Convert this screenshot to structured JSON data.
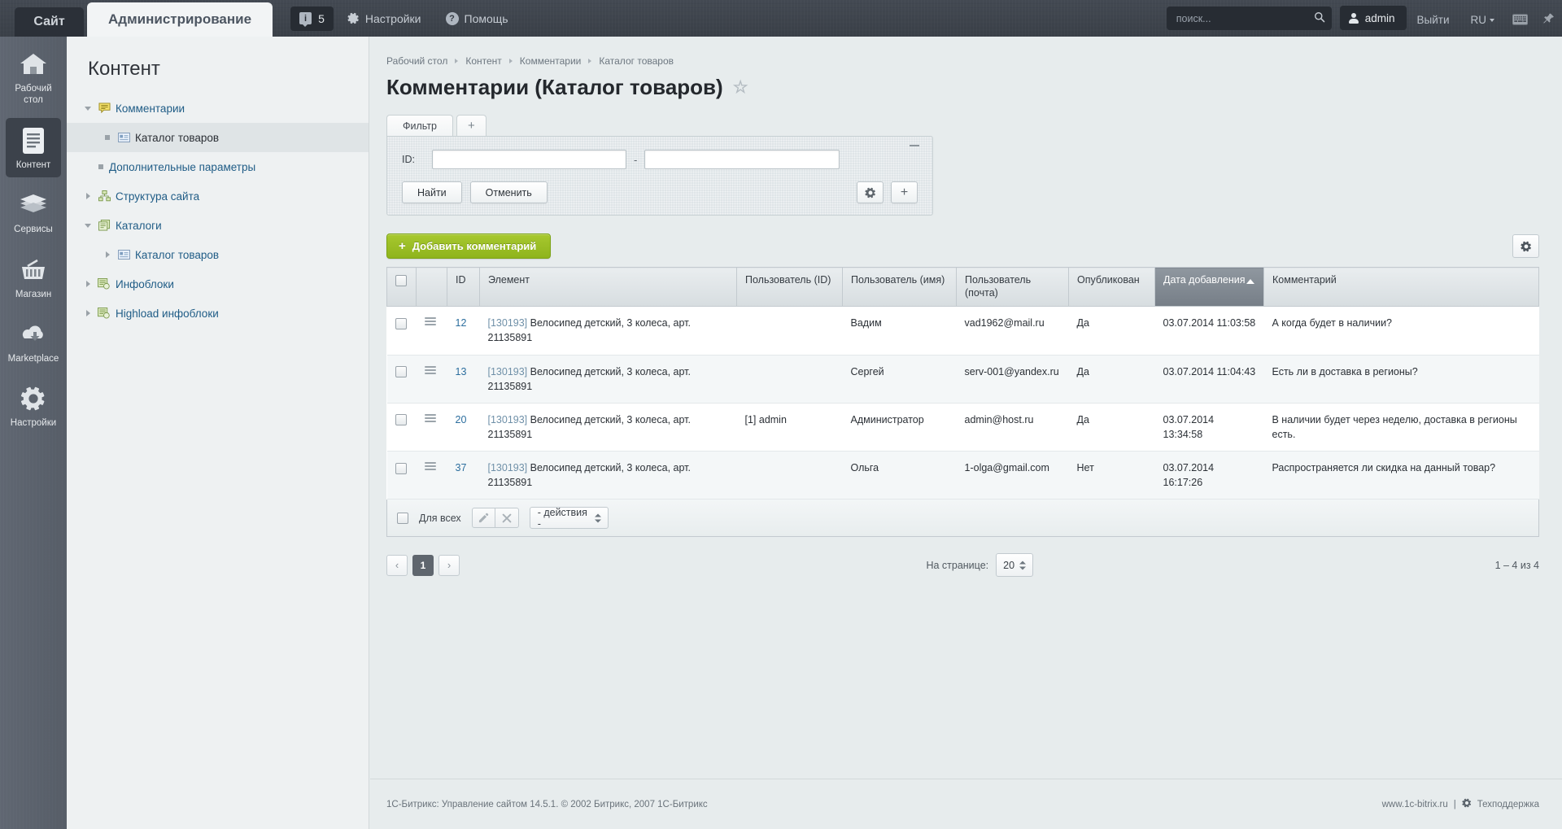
{
  "header": {
    "tab_site": "Сайт",
    "tab_admin": "Администрирование",
    "counter_badge_icon": "info-icon",
    "counter_value": "5",
    "settings_label": "Настройки",
    "help_label": "Помощь",
    "search_placeholder": "поиск...",
    "search_value": "",
    "user_name": "admin",
    "logout_label": "Выйти",
    "language": "RU",
    "keyboard_icon": "keyboard-icon",
    "pin_icon": "pin-icon"
  },
  "rail": {
    "items": [
      {
        "label": "Рабочий стол",
        "icon": "home-icon",
        "active": false
      },
      {
        "label": "Контент",
        "icon": "document-icon",
        "active": true
      },
      {
        "label": "Сервисы",
        "icon": "layers-icon",
        "active": false
      },
      {
        "label": "Магазин",
        "icon": "basket-icon",
        "active": false
      },
      {
        "label": "Marketplace",
        "icon": "cloud-download-icon",
        "active": false
      },
      {
        "label": "Настройки",
        "icon": "gear-icon",
        "active": false
      }
    ]
  },
  "tree": {
    "title": "Контент",
    "items": [
      {
        "label": "Комментарии",
        "icon": "comment-icon",
        "toggle": "down",
        "level": 0,
        "selected": false
      },
      {
        "label": "Каталог товаров",
        "icon": "card-icon",
        "toggle": "dot",
        "level": 1,
        "selected": true
      },
      {
        "label": "Дополнительные параметры",
        "icon": "none",
        "toggle": "dot",
        "level": 0,
        "selected": false
      },
      {
        "label": "Структура сайта",
        "icon": "sitemap-icon",
        "toggle": "right",
        "level": 0,
        "selected": false
      },
      {
        "label": "Каталоги",
        "icon": "catalog-icon",
        "toggle": "down",
        "level": 0,
        "selected": false
      },
      {
        "label": "Каталог товаров",
        "icon": "card-icon",
        "toggle": "right",
        "level": 1,
        "selected": false
      },
      {
        "label": "Инфоблоки",
        "icon": "infoblock-icon",
        "toggle": "right",
        "level": 0,
        "selected": false
      },
      {
        "label": "Highload инфоблоки",
        "icon": "infoblock-icon",
        "toggle": "right",
        "level": 0,
        "selected": false
      }
    ]
  },
  "breadcrumb": [
    "Рабочий стол",
    "Контент",
    "Комментарии",
    "Каталог товаров"
  ],
  "page": {
    "title": "Комментарии (Каталог товаров)",
    "favorite_icon": "star-icon"
  },
  "filter": {
    "tab_label": "Фильтр",
    "add_tab_icon": "plus-icon",
    "collapse_icon": "minus-icon",
    "id_label": "ID:",
    "id_from_value": "",
    "id_to_value": "",
    "range_separator": "-",
    "find_label": "Найти",
    "cancel_label": "Отменить",
    "settings_icon": "gear-icon",
    "add_icon": "plus-icon"
  },
  "grid": {
    "add_button_label": "Добавить комментарий",
    "add_button_icon": "plus-icon",
    "add_button_color": "#8fb41c",
    "settings_icon": "gear-icon",
    "columns": [
      {
        "key": "checkbox",
        "label": ""
      },
      {
        "key": "menu",
        "label": ""
      },
      {
        "key": "id",
        "label": "ID"
      },
      {
        "key": "element",
        "label": "Элемент"
      },
      {
        "key": "user_id",
        "label": "Пользователь (ID)"
      },
      {
        "key": "user_name",
        "label": "Пользователь (имя)"
      },
      {
        "key": "user_mail",
        "label": "Пользователь (почта)"
      },
      {
        "key": "published",
        "label": "Опубликован"
      },
      {
        "key": "date_added",
        "label": "Дата добавления",
        "sorted": true,
        "sort_dir": "asc"
      },
      {
        "key": "comment",
        "label": "Комментарий"
      }
    ],
    "rows": [
      {
        "id": "12",
        "element_id": "[130193]",
        "element_name": "Велосипед детский, 3 колеса, арт. 21135891",
        "user_id": "",
        "user_name": "Вадим",
        "user_mail": "vad1962@mail.ru",
        "published": "Да",
        "date_added": "03.07.2014 11:03:58",
        "comment": "А когда будет в наличии?"
      },
      {
        "id": "13",
        "element_id": "[130193]",
        "element_name": "Велосипед детский, 3 колеса, арт. 21135891",
        "user_id": "",
        "user_name": "Сергей",
        "user_mail": "serv-001@yandex.ru",
        "published": "Да",
        "date_added": "03.07.2014 11:04:43",
        "comment": "Есть ли в доставка в регионы?"
      },
      {
        "id": "20",
        "element_id": "[130193]",
        "element_name": "Велосипед детский, 3 колеса, арт. 21135891",
        "user_id": "[1] admin",
        "user_name": "Администратор",
        "user_mail": "admin@host.ru",
        "published": "Да",
        "date_added": "03.07.2014 13:34:58",
        "comment": "В наличии будет через неделю, доставка в регионы есть."
      },
      {
        "id": "37",
        "element_id": "[130193]",
        "element_name": "Велосипед детский, 3 колеса, арт. 21135891",
        "user_id": "",
        "user_name": "Ольга",
        "user_mail": "1-olga@gmail.com",
        "published": "Нет",
        "date_added": "03.07.2014 16:17:26",
        "comment": "Распространяется ли скидка на данный товар?"
      }
    ],
    "footer": {
      "select_all_label": "Для всех",
      "edit_icon": "pencil-icon",
      "delete_icon": "close-icon",
      "action_select_value": "- действия -"
    }
  },
  "pagination": {
    "prev_icon": "chevron-left-icon",
    "next_icon": "chevron-right-icon",
    "current_page": "1",
    "per_page_label": "На странице:",
    "per_page_value": "20",
    "total_label": "1 – 4 из 4"
  },
  "footer": {
    "copyright": "1С-Битрикс: Управление сайтом 14.5.1. © 2002 Битрикс, 2007 1С-Битрикс",
    "site_link": "www.1c-bitrix.ru",
    "divider": "|",
    "support_icon": "gear-icon",
    "support_label": "Техподдержка"
  }
}
